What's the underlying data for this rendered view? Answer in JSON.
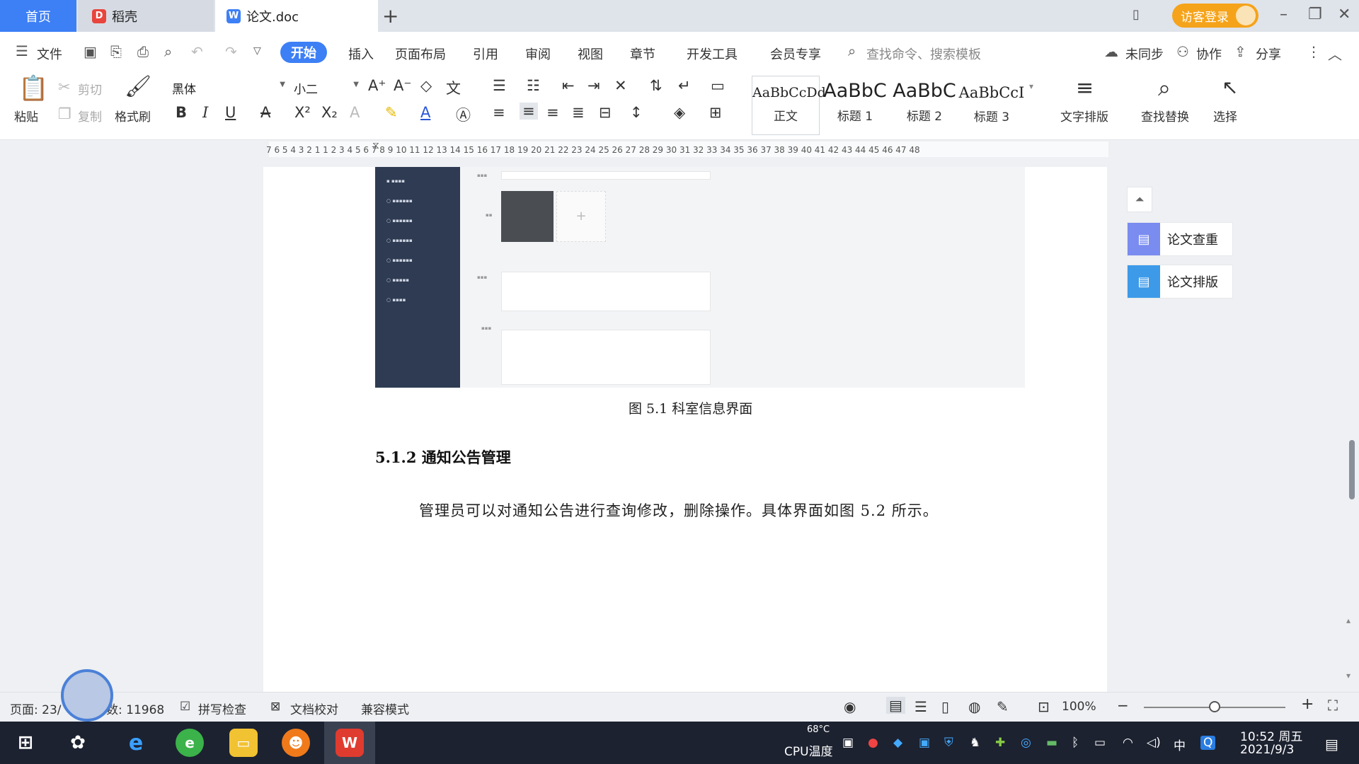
{
  "tabs": {
    "home": "首页",
    "daoke": "稻壳",
    "doc": "论文.doc"
  },
  "titlebar": {
    "login": "访客登录"
  },
  "menu": {
    "file": "文件",
    "items": [
      "开始",
      "插入",
      "页面布局",
      "引用",
      "审阅",
      "视图",
      "章节",
      "开发工具",
      "会员专享"
    ],
    "search_placeholder": "查找命令、搜索模板",
    "sync": "未同步",
    "collab": "协作",
    "share": "分享"
  },
  "ribbon": {
    "paste": "粘贴",
    "cut": "剪切",
    "copy": "复制",
    "format_painter": "格式刷",
    "font_name": "黑体",
    "font_size": "小二",
    "styles": [
      {
        "preview": "AaBbCcDd",
        "label": "正文"
      },
      {
        "preview": "AaBbC",
        "label": "标题 1"
      },
      {
        "preview": "AaBbC",
        "label": "标题 2"
      },
      {
        "preview": "AaBbCcI",
        "label": "标题 3"
      }
    ],
    "text_layout": "文字排版",
    "find_replace": "查找替换",
    "select": "选择"
  },
  "ruler": {
    "labels": "7 6 5 4 3 2 1   1 2 3 4 5 6 7 8 9 10 11 12 13 14 15 16 17 18 19 20 21 22 23 24 25 26 27 28 29 30 31 32 33 34 35 36 37 38 39 40 41 42 43 44 45 46 47 48"
  },
  "document": {
    "caption": "图 5.1  科室信息界面",
    "heading": "5.1.2  通知公告管理",
    "paragraph": "管理员可以对通知公告进行查询修改，删除操作。具体界面如图 5.2 所示。"
  },
  "side_panel": {
    "check": "论文查重",
    "layout": "论文排版"
  },
  "status": {
    "page": "页面: 23/",
    "words": "数: 11968",
    "spell": "拼写检查",
    "proof": "文档校对",
    "compat": "兼容模式",
    "zoom": "100%"
  },
  "taskbar": {
    "temp": "68°C",
    "cpu": "CPU温度",
    "ime": "中",
    "time": "10:52 周五",
    "date": "2021/9/3"
  },
  "colors": {
    "accent": "#3d7ff5",
    "login": "#f5a31a",
    "taskbar": "#1c2230"
  }
}
